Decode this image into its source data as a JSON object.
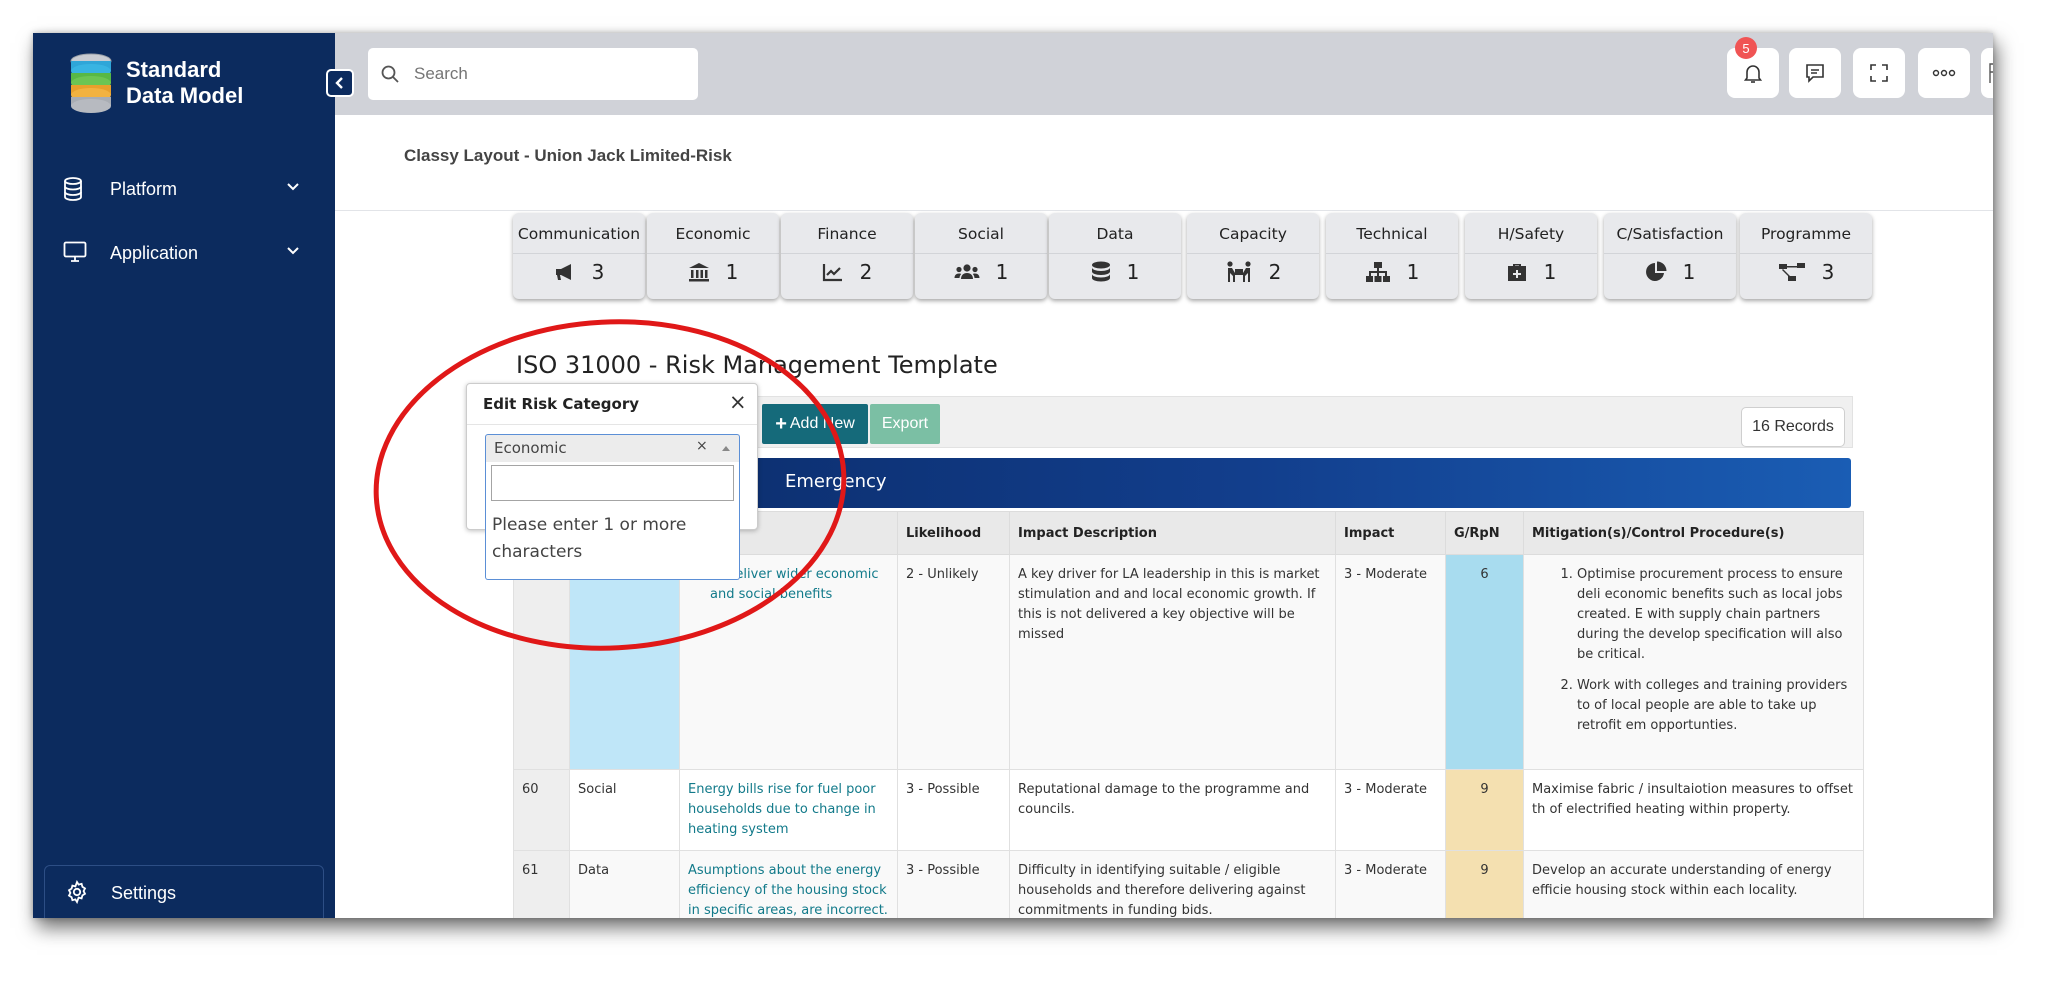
{
  "app": {
    "title_line1": "Standard",
    "title_line2": "Data Model"
  },
  "sidebar": {
    "items": [
      {
        "label": "Platform",
        "icon": "database-icon"
      },
      {
        "label": "Application",
        "icon": "monitor-icon"
      }
    ],
    "settings_label": "Settings"
  },
  "topbar": {
    "search_placeholder": "Search",
    "notification_count": "5"
  },
  "breadcrumb": "Classy Layout - Union Jack Limited-Risk",
  "categories": [
    {
      "name": "Communication",
      "count": "3",
      "icon": "megaphone-icon"
    },
    {
      "name": "Economic",
      "count": "1",
      "icon": "bank-icon"
    },
    {
      "name": "Finance",
      "count": "2",
      "icon": "chart-line-icon"
    },
    {
      "name": "Social",
      "count": "1",
      "icon": "users-icon"
    },
    {
      "name": "Data",
      "count": "1",
      "icon": "database-icon"
    },
    {
      "name": "Capacity",
      "count": "2",
      "icon": "people-carry-icon"
    },
    {
      "name": "Technical",
      "count": "1",
      "icon": "sitemap-icon"
    },
    {
      "name": "H/Safety",
      "count": "1",
      "icon": "first-aid-icon"
    },
    {
      "name": "C/Satisfaction",
      "count": "1",
      "icon": "pie-chart-icon"
    },
    {
      "name": "Programme",
      "count": "3",
      "icon": "project-diagram-icon"
    }
  ],
  "page_title": "ISO 31000 - Risk Management Template",
  "toolbar": {
    "add_label": "Add New",
    "export_label": "Export",
    "records_label": "16 Records"
  },
  "group_header": "Emergency",
  "table": {
    "headers": [
      "",
      "",
      "",
      "Likelihood",
      "Impact Description",
      "Impact",
      "G/RpN",
      "Mitigation(s)/Control Procedure(s)"
    ],
    "rows": [
      {
        "id": "",
        "category": "",
        "risk": "to deliver wider economic and social benefits",
        "likelihood": "2 - Unlikely",
        "impact_description": "A key driver for LA leadership in this is market stimulation and and local economic growth. If this is not delivered a key objective will be missed",
        "impact": "3 - Moderate",
        "rpn": "6",
        "rpn_color": "#a8dcef",
        "mitigation_list": [
          "Optimise procurement process to ensure deli economic benefits such as local jobs created. E with supply chain partners during the develop specification will also be critical.",
          "Work with colleges and training providers to of local people are able to take up retrofit em opportunties."
        ]
      },
      {
        "id": "60",
        "category": "Social",
        "risk": "Energy bills rise for fuel poor households due to change in heating system",
        "likelihood": "3 - Possible",
        "impact_description": "Reputational damage to the programme and councils.",
        "impact": "3 - Moderate",
        "rpn": "9",
        "rpn_color": "#f4e0b0",
        "mitigation": "Maximise fabric / insultaiotion  measures to offset th of electrified heating within property."
      },
      {
        "id": "61",
        "category": "Data",
        "risk": "Asumptions about the energy efficiency of the housing stock in specific areas, are incorrect.",
        "likelihood": "3 - Possible",
        "impact_description": "Difficulty in identifying suitable / eligible households and therefore delivering against commitments in funding bids.",
        "impact": "3 - Moderate",
        "rpn": "9",
        "rpn_color": "#f4e0b0",
        "mitigation": "Develop an accurate understanding of energy efficie housing stock within each locality."
      }
    ]
  },
  "popup": {
    "title": "Edit Risk Category",
    "selected_value": "Economic",
    "hint": "Please enter 1 or more characters"
  },
  "colors": {
    "sidebar": "#0c2b5e",
    "accent_teal": "#156a7a",
    "export_green": "#7bbfa4",
    "annotation_red": "#e01818",
    "badge_red": "#f05454"
  }
}
